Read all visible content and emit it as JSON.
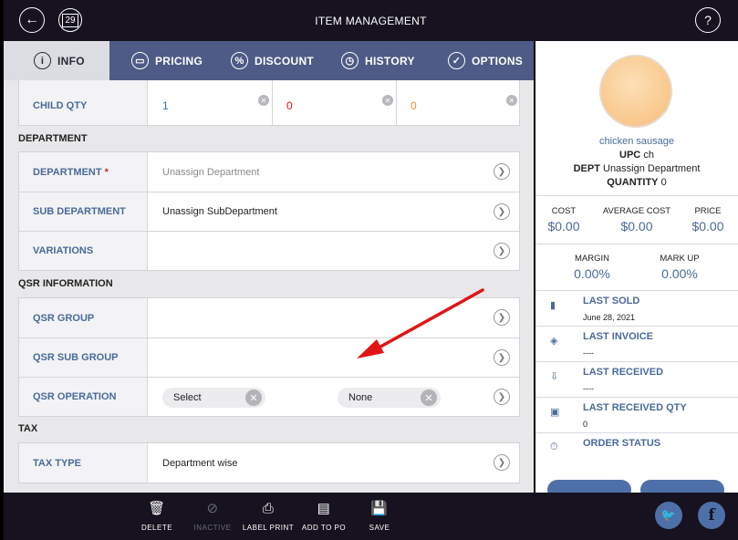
{
  "header": {
    "title": "ITEM MANAGEMENT",
    "calendar_day": "29",
    "back_icon": "back-arrow-icon",
    "help_icon": "?"
  },
  "tabs": [
    {
      "label": "INFO",
      "icon": "i",
      "active": true
    },
    {
      "label": "PRICING",
      "icon": "▭",
      "active": false
    },
    {
      "label": "DISCOUNT",
      "icon": "%",
      "active": false
    },
    {
      "label": "HISTORY",
      "icon": "◷",
      "active": false
    },
    {
      "label": "OPTIONS",
      "icon": "✓",
      "active": false
    }
  ],
  "child_qty": {
    "label": "CHILD QTY",
    "values": [
      "1",
      "0",
      "0"
    ],
    "colors": [
      "#3a6fc0",
      "#d01818",
      "#e8901e"
    ]
  },
  "department": {
    "section": "DEPARTMENT",
    "rows": [
      {
        "label": "DEPARTMENT",
        "required": "*",
        "value": "Unassign Department"
      },
      {
        "label": "SUB DEPARTMENT",
        "value": "Unassign SubDepartment"
      },
      {
        "label": "VARIATIONS",
        "value": ""
      }
    ]
  },
  "qsr": {
    "section": "QSR INFORMATION",
    "rows": [
      {
        "label": "QSR GROUP",
        "value": ""
      },
      {
        "label": "QSR SUB GROUP",
        "value": ""
      },
      {
        "label": "QSR OPERATION",
        "pill1": "Select",
        "pill2": "None"
      }
    ]
  },
  "tax": {
    "section": "TAX",
    "rows": [
      {
        "label": "TAX TYPE",
        "value": "Department wise"
      }
    ]
  },
  "item": {
    "name": "chicken sausage",
    "upc_label": "UPC",
    "upc": "ch",
    "dept_label": "DEPT",
    "dept": "Unassign Department",
    "qty_label": "QUANTITY",
    "qty": "0"
  },
  "pricing": {
    "cost_label": "COST",
    "cost": "$0.00",
    "avg_label": "AVERAGE COST",
    "avg": "$0.00",
    "price_label": "PRICE",
    "price": "$0.00",
    "margin_label": "MARGIN",
    "margin": "0.00%",
    "markup_label": "MARK UP",
    "markup": "0.00%"
  },
  "activity": [
    {
      "label": "LAST SOLD",
      "value": "June 28, 2021",
      "icon": "bag-icon"
    },
    {
      "label": "LAST INVOICE",
      "value": "----",
      "icon": "layers-icon"
    },
    {
      "label": "LAST RECEIVED",
      "value": "----",
      "icon": "inbox-icon"
    },
    {
      "label": "LAST RECEIVED QTY",
      "value": "0",
      "icon": "box-icon"
    },
    {
      "label": "ORDER STATUS",
      "value": "",
      "icon": "timer-icon"
    }
  ],
  "toolbar": [
    {
      "label": "DELETE",
      "glyph": "🗑",
      "enabled": true
    },
    {
      "label": "INACTIVE",
      "glyph": "⊘",
      "enabled": false
    },
    {
      "label": "LABEL PRINT",
      "glyph": "⎙",
      "enabled": true
    },
    {
      "label": "ADD TO PO",
      "glyph": "▤",
      "enabled": true
    },
    {
      "label": "SAVE",
      "glyph": "💾",
      "enabled": true
    }
  ],
  "social": {
    "twitter": "🐦",
    "facebook": "f"
  },
  "colors": {
    "accent": "#4a6a9a",
    "tabbar": "#4e5b86",
    "header": "#16121f",
    "arrow": "#e01515"
  }
}
